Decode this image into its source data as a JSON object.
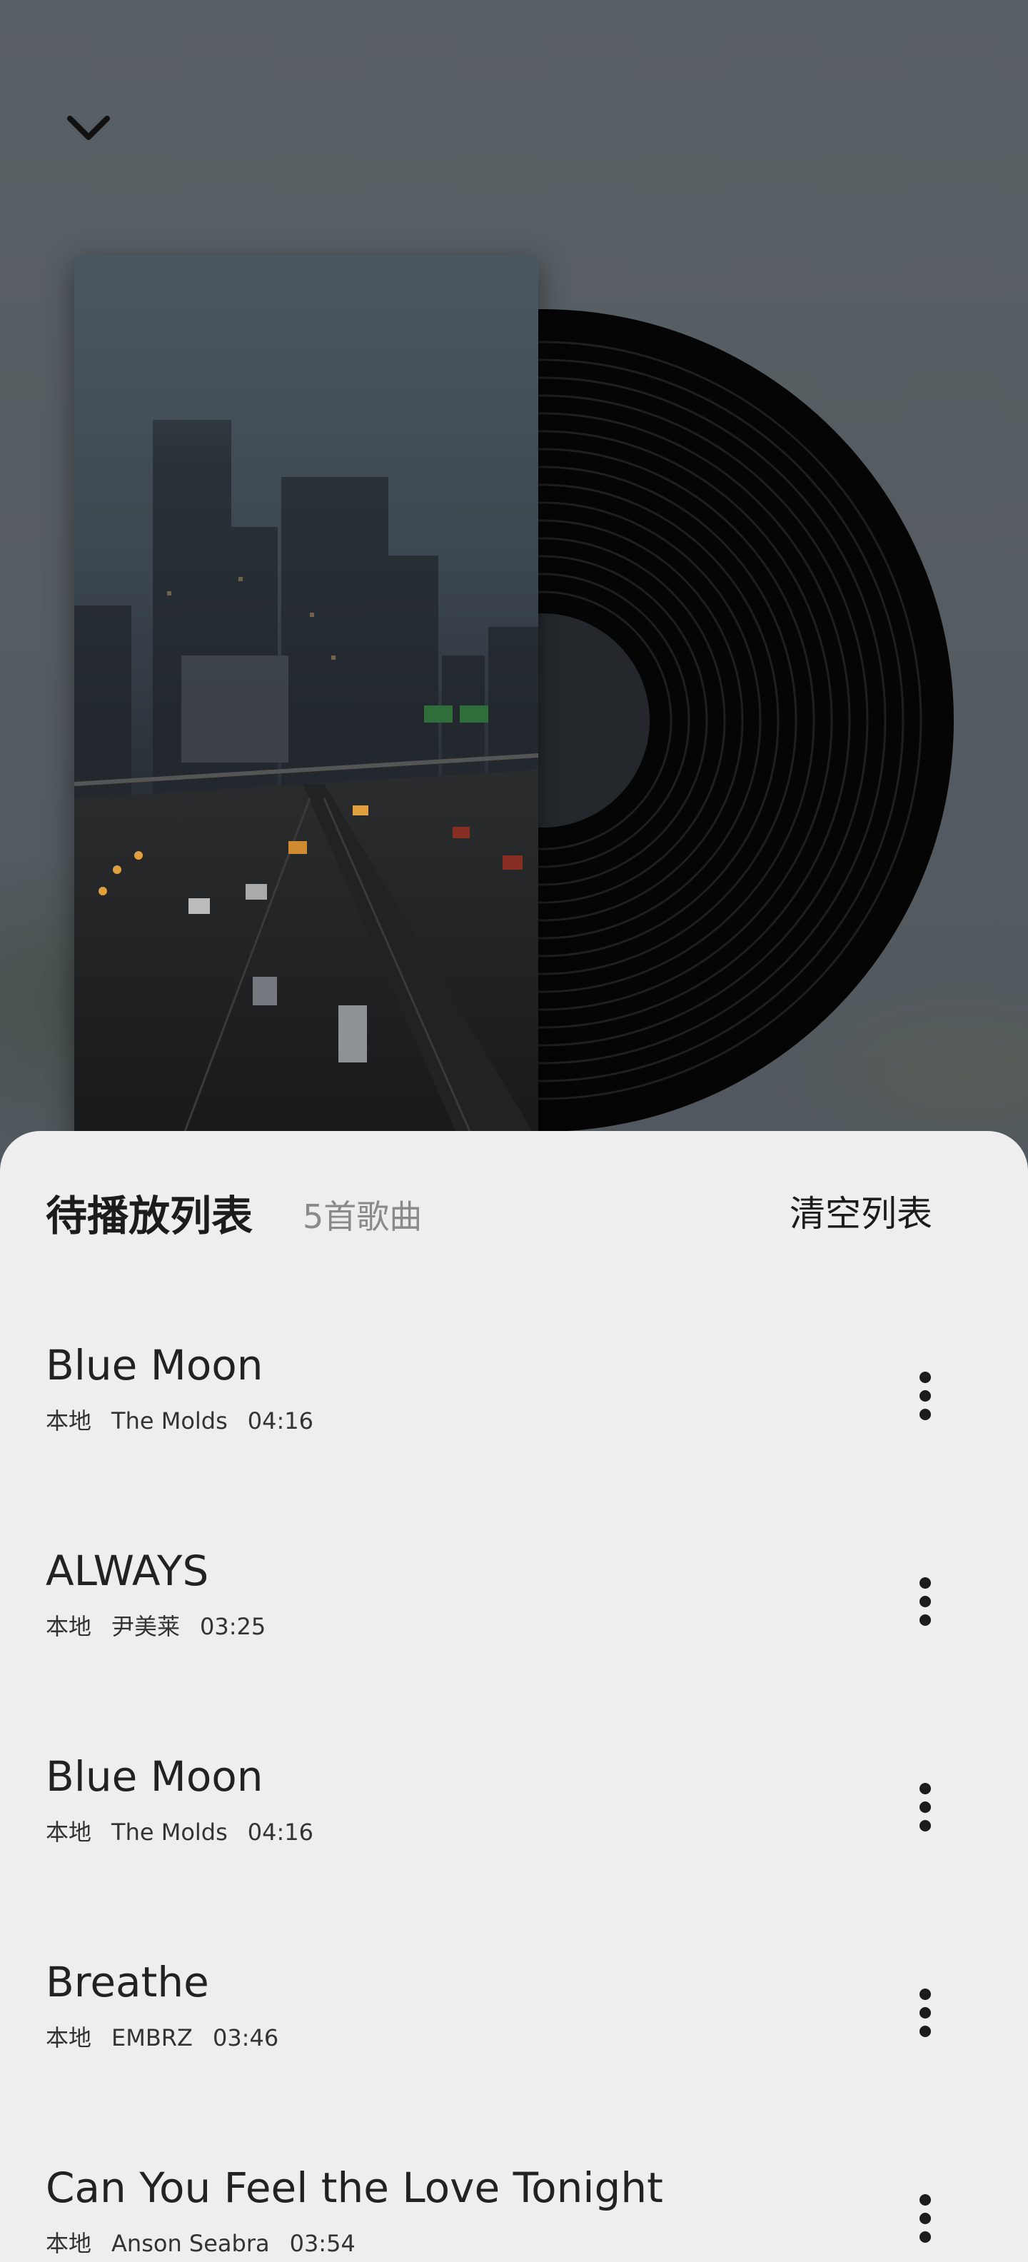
{
  "header": {
    "collapse_icon": "chevron-down-icon"
  },
  "now_playing": {
    "cover_icon": "album-cover-city-highway",
    "disc_icon": "vinyl-record-icon"
  },
  "queue": {
    "title": "待播放列表",
    "count_label": "5首歌曲",
    "clear_label": "清空列表",
    "more_icon": "more-vertical-icon",
    "songs": [
      {
        "title": "Blue Moon",
        "source": "本地",
        "artist": "The Molds",
        "duration": "04:16"
      },
      {
        "title": "ALWAYS",
        "source": "本地",
        "artist": "尹美莱",
        "duration": "03:25"
      },
      {
        "title": "Blue Moon",
        "source": "本地",
        "artist": "The Molds",
        "duration": "04:16"
      },
      {
        "title": "Breathe",
        "source": "本地",
        "artist": "EMBRZ",
        "duration": "03:46"
      },
      {
        "title": "Can You Feel the Love Tonight",
        "source": "本地",
        "artist": "Anson Seabra",
        "duration": "03:54"
      }
    ]
  },
  "colors": {
    "sheet_bg": "#eeeeee",
    "text_primary": "#222222",
    "text_secondary": "#8a8a8a"
  }
}
